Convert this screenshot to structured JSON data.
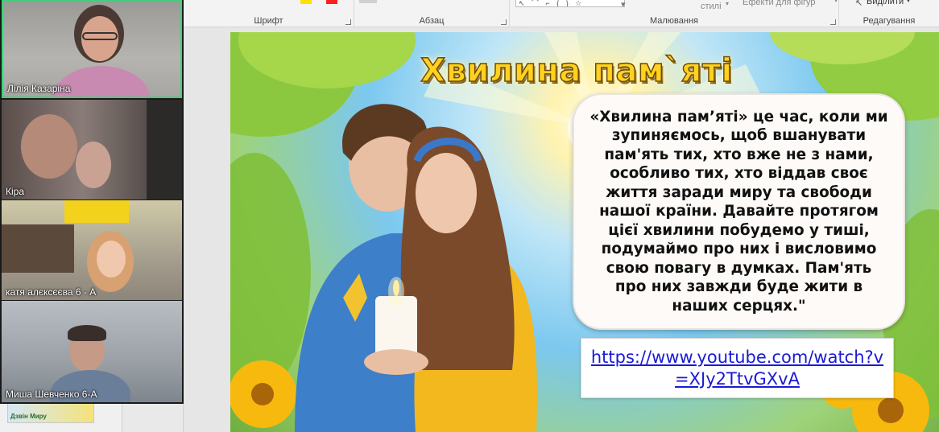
{
  "ribbon": {
    "groups": {
      "font": "Шрифт",
      "paragraph": "Абзац",
      "drawing": "Малювання",
      "editing": "Редагування"
    },
    "styles_label": "стилі",
    "effects_label": "Ефекти для фігур",
    "select_label": "Виділити"
  },
  "participants": [
    {
      "name": "Лілія Казаріна",
      "active": true
    },
    {
      "name": "Кіра",
      "active": false
    },
    {
      "name": "катя алєксєєва 6 - А",
      "active": false
    },
    {
      "name": "Миша Шевченко 6-А",
      "active": false
    }
  ],
  "thumbnail": {
    "text": "Дзвін Миру"
  },
  "slide": {
    "title": "Хвилина пам`яті",
    "body": "«Хвилина пам’яті» це час, коли ми зупиняємось, щоб вшанувати пам'ять тих, хто вже не з нами, особливо тих, хто віддав своє життя заради миру та свободи нашої країни. Давайте протягом цієї хвилини побудемо у тиші, подумаймо про них і висловимо свою повагу в думках. Пам'ять про них завжди буде жити в наших серцях.\"",
    "link": "https://www.youtube.com/watch?v=XJy2TtvGXvA"
  },
  "colors": {
    "active_speaker": "#3fd17a",
    "title_fill": "#ffd21f",
    "link": "#1a1ad6"
  }
}
